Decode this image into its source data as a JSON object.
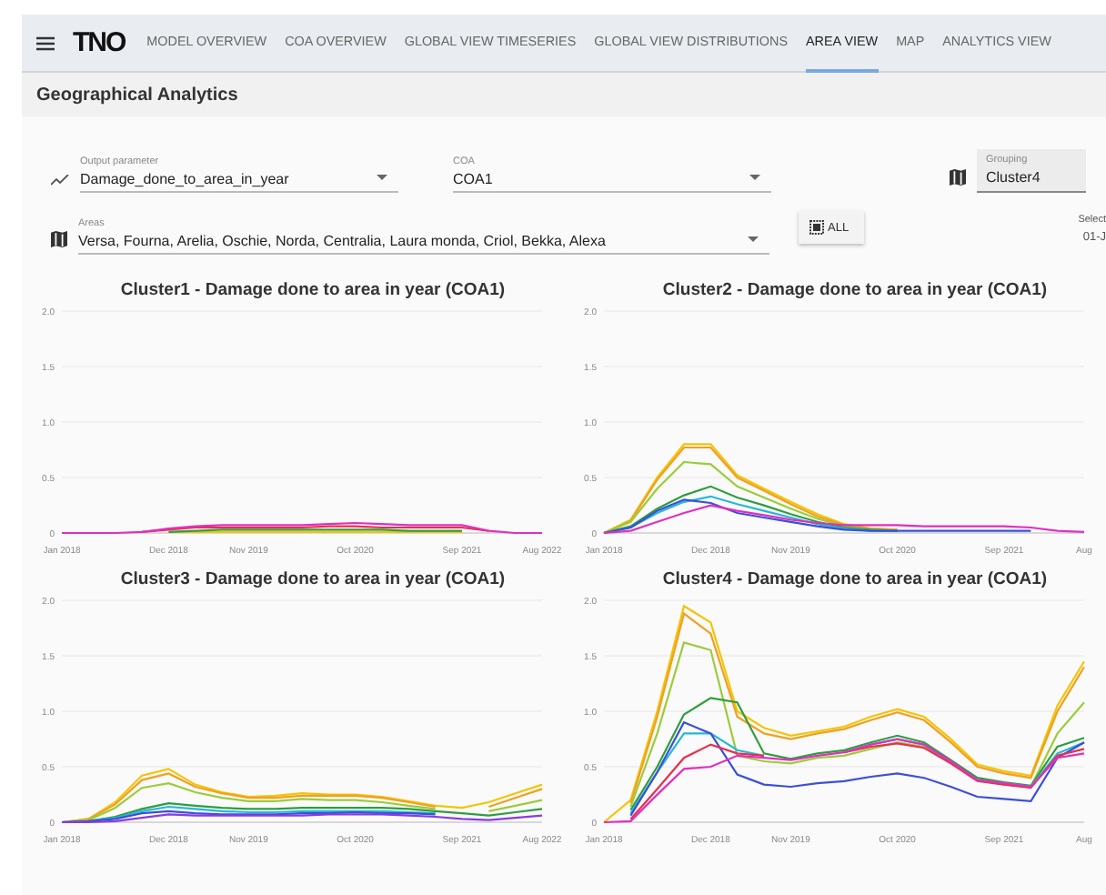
{
  "nav": {
    "logo": "TNO",
    "tabs": [
      {
        "label": "MODEL OVERVIEW",
        "selected": false
      },
      {
        "label": "COA OVERVIEW",
        "selected": false
      },
      {
        "label": "GLOBAL VIEW TIMESERIES",
        "selected": false
      },
      {
        "label": "GLOBAL VIEW DISTRIBUTIONS",
        "selected": false
      },
      {
        "label": "AREA VIEW",
        "selected": true
      },
      {
        "label": "MAP",
        "selected": false
      },
      {
        "label": "ANALYTICS VIEW",
        "selected": false
      }
    ]
  },
  "section_title": "Geographical Analytics",
  "controls": {
    "output_parameter": {
      "label": "Output parameter",
      "value": "Damage_done_to_area_in_year"
    },
    "coa": {
      "label": "COA",
      "value": "COA1"
    },
    "grouping": {
      "label": "Grouping",
      "value": "Cluster4"
    },
    "areas": {
      "label": "Areas",
      "value": "Versa, Fourna, Arelia, Oschie, Norda, Centralia, Laura monda, Criol, Bekka, Alexa"
    },
    "all_button": "ALL",
    "select": {
      "label": "Select",
      "value": "01-J"
    }
  },
  "charts": [
    {
      "chart_data": {
        "type": "line",
        "title": "Cluster1 - Damage done to area in year (COA1)",
        "categories": [
          "Jan 2018",
          null,
          null,
          null,
          "Dec 2018",
          null,
          null,
          "Nov 2019",
          null,
          null,
          null,
          "Oct 2020",
          null,
          null,
          null,
          "Sep 2021",
          null,
          null,
          "Aug 2022"
        ],
        "ylim": [
          0,
          2
        ],
        "grid": true,
        "yticks": [
          {
            "value": 0,
            "label": "0"
          },
          {
            "value": 0.5,
            "label": "0.5"
          },
          {
            "value": 1,
            "label": "1.0"
          },
          {
            "value": 1.5,
            "label": "1.5"
          },
          {
            "value": 2,
            "label": "2.0"
          }
        ],
        "series": [
          {
            "color": "#f5c400",
            "values": [
              null,
              null,
              null,
              null,
              0.01,
              0.01,
              0.01,
              0.01,
              0.01,
              0.01,
              0.01,
              0.01,
              0.01,
              0.01,
              0.01,
              0.01,
              null,
              null,
              null
            ]
          },
          {
            "color": "#2e9e3e",
            "values": [
              null,
              null,
              null,
              null,
              0.01,
              0.02,
              0.03,
              0.03,
              0.03,
              0.03,
              0.03,
              0.03,
              0.03,
              0.02,
              0.02,
              0.02,
              null,
              null,
              null
            ]
          },
          {
            "color": "#e8304a",
            "values": [
              null,
              null,
              null,
              0.01,
              0.03,
              0.05,
              0.05,
              0.05,
              0.05,
              0.05,
              0.06,
              0.06,
              0.05,
              0.05,
              0.05,
              0.05,
              0.02,
              null,
              null
            ]
          },
          {
            "color": "#e030c0",
            "values": [
              0,
              0,
              0,
              0.01,
              0.04,
              0.06,
              0.07,
              0.07,
              0.07,
              0.07,
              0.08,
              0.09,
              0.08,
              0.07,
              0.07,
              0.07,
              0.02,
              0,
              0
            ]
          }
        ]
      }
    },
    {
      "chart_data": {
        "type": "line",
        "title": "Cluster2 - Damage done to area in year (COA1)",
        "categories": [
          "Jan 2018",
          null,
          null,
          null,
          "Dec 2018",
          null,
          null,
          "Nov 2019",
          null,
          null,
          null,
          "Oct 2020",
          null,
          null,
          null,
          "Sep 2021",
          null,
          null,
          "Aug"
        ],
        "ylim": [
          0,
          2
        ],
        "grid": true,
        "yticks": [
          {
            "value": 0,
            "label": "0"
          },
          {
            "value": 0.5,
            "label": "0.5"
          },
          {
            "value": 1,
            "label": "1.0"
          },
          {
            "value": 1.5,
            "label": "1.5"
          },
          {
            "value": 2,
            "label": "2.0"
          }
        ],
        "series": [
          {
            "color": "#f5c400",
            "values": [
              0,
              0.12,
              0.5,
              0.8,
              0.8,
              0.52,
              0.4,
              0.28,
              0.17,
              0.08,
              0.04,
              0.03,
              null,
              null,
              null,
              null,
              null,
              null,
              null
            ]
          },
          {
            "color": "#f0a020",
            "values": [
              0,
              0.11,
              0.48,
              0.77,
              0.77,
              0.5,
              0.38,
              0.26,
              0.15,
              0.07,
              0.04,
              0.03,
              null,
              null,
              null,
              null,
              null,
              null,
              null
            ]
          },
          {
            "color": "#9ccc3c",
            "values": [
              0,
              0.1,
              0.4,
              0.64,
              0.62,
              0.42,
              0.32,
              0.22,
              0.13,
              0.06,
              0.03,
              0.02,
              null,
              null,
              null,
              null,
              null,
              null,
              null
            ]
          },
          {
            "color": "#2e9e3e",
            "values": [
              0,
              0.06,
              0.22,
              0.34,
              0.42,
              0.32,
              0.25,
              0.17,
              0.1,
              0.05,
              0.03,
              0.02,
              null,
              null,
              null,
              null,
              null,
              null,
              null
            ]
          },
          {
            "color": "#25b8d8",
            "values": [
              0,
              0.05,
              0.18,
              0.28,
              0.33,
              0.26,
              0.2,
              0.14,
              0.08,
              0.04,
              0.02,
              0.02,
              null,
              null,
              null,
              null,
              null,
              null,
              null
            ]
          },
          {
            "color": "#3b4fd8",
            "values": [
              0,
              0.05,
              0.2,
              0.3,
              0.27,
              0.18,
              0.14,
              0.1,
              0.06,
              0.03,
              0.02,
              0.02,
              0.02,
              0.02,
              0.02,
              0.02,
              0.02,
              null,
              null
            ]
          },
          {
            "color": "#e030c0",
            "values": [
              0,
              0.02,
              0.1,
              0.18,
              0.25,
              0.2,
              0.16,
              0.12,
              0.09,
              0.07,
              0.07,
              0.07,
              0.06,
              0.06,
              0.06,
              0.06,
              0.05,
              0.02,
              0.01
            ]
          }
        ]
      }
    },
    {
      "chart_data": {
        "type": "line",
        "title": "Cluster3 - Damage done to area in year (COA1)",
        "categories": [
          "Jan 2018",
          null,
          null,
          null,
          "Dec 2018",
          null,
          null,
          "Nov 2019",
          null,
          null,
          null,
          "Oct 2020",
          null,
          null,
          null,
          "Sep 2021",
          null,
          null,
          "Aug 2022"
        ],
        "ylim": [
          0,
          2
        ],
        "grid": true,
        "yticks": [
          {
            "value": 0,
            "label": "0"
          },
          {
            "value": 0.5,
            "label": "0.5"
          },
          {
            "value": 1,
            "label": "1.0"
          },
          {
            "value": 1.5,
            "label": "1.5"
          },
          {
            "value": 2,
            "label": "2.0"
          }
        ],
        "series": [
          {
            "color": "#f5c400",
            "values": [
              0,
              0.03,
              0.18,
              0.42,
              0.48,
              0.34,
              0.27,
              0.23,
              0.24,
              0.26,
              0.25,
              0.25,
              0.23,
              0.19,
              0.15,
              0.13,
              0.18,
              0.26,
              0.34
            ]
          },
          {
            "color": "#f0a020",
            "values": [
              0,
              0.03,
              0.16,
              0.38,
              0.44,
              0.32,
              0.26,
              0.22,
              0.22,
              0.24,
              0.24,
              0.24,
              0.22,
              0.18,
              0.14,
              null,
              0.14,
              0.22,
              0.3
            ]
          },
          {
            "color": "#9ccc3c",
            "values": [
              0,
              0.02,
              0.13,
              0.31,
              0.35,
              0.27,
              0.22,
              0.19,
              0.19,
              0.21,
              0.2,
              0.2,
              0.18,
              0.15,
              0.12,
              null,
              0.1,
              0.15,
              0.2
            ]
          },
          {
            "color": "#2e9e3e",
            "values": [
              0,
              0.01,
              0.05,
              0.12,
              0.17,
              0.15,
              0.13,
              0.12,
              0.12,
              0.13,
              0.13,
              0.13,
              0.13,
              0.12,
              0.1,
              0.08,
              0.06,
              0.09,
              0.12
            ]
          },
          {
            "color": "#25b8d8",
            "values": [
              0,
              0.01,
              0.04,
              0.1,
              0.14,
              0.12,
              0.1,
              0.09,
              0.09,
              0.1,
              0.1,
              0.1,
              0.1,
              0.09,
              0.08,
              null,
              null,
              null,
              null
            ]
          },
          {
            "color": "#3b4fd8",
            "values": [
              0,
              0.01,
              0.03,
              0.08,
              0.1,
              0.08,
              0.07,
              0.07,
              0.07,
              0.08,
              0.08,
              0.09,
              0.08,
              0.08,
              0.07,
              null,
              null,
              null,
              null
            ]
          },
          {
            "color": "#8a3be0",
            "values": [
              0,
              0,
              0.01,
              0.04,
              0.07,
              0.06,
              0.06,
              0.06,
              0.06,
              0.06,
              0.07,
              0.07,
              0.07,
              0.06,
              0.05,
              0.03,
              0.02,
              0.04,
              0.06
            ]
          }
        ]
      }
    },
    {
      "chart_data": {
        "type": "line",
        "title": "Cluster4 - Damage done to area in year (COA1)",
        "categories": [
          "Jan 2018",
          null,
          null,
          null,
          "Dec 2018",
          null,
          null,
          "Nov 2019",
          null,
          null,
          null,
          "Oct 2020",
          null,
          null,
          null,
          "Sep 2021",
          null,
          null,
          "Aug"
        ],
        "ylim": [
          0,
          2
        ],
        "grid": true,
        "yticks": [
          {
            "value": 0,
            "label": "0"
          },
          {
            "value": 0.5,
            "label": "0.5"
          },
          {
            "value": 1,
            "label": "1.0"
          },
          {
            "value": 1.5,
            "label": "1.5"
          },
          {
            "value": 2,
            "label": "2.0"
          }
        ],
        "series": [
          {
            "color": "#f5c400",
            "values": [
              0,
              0.2,
              1.0,
              1.95,
              1.8,
              1.0,
              0.85,
              0.78,
              0.82,
              0.86,
              0.95,
              1.02,
              0.95,
              0.75,
              0.52,
              0.46,
              0.42,
              1.05,
              1.45
            ]
          },
          {
            "color": "#f0a020",
            "values": [
              null,
              0.17,
              0.95,
              1.88,
              1.7,
              0.95,
              0.8,
              0.75,
              0.8,
              0.84,
              0.92,
              0.99,
              0.92,
              0.72,
              0.5,
              0.44,
              0.4,
              1.0,
              1.4
            ]
          },
          {
            "color": "#9ccc3c",
            "values": [
              null,
              0.14,
              0.8,
              1.62,
              1.55,
              0.6,
              0.55,
              0.53,
              0.58,
              0.6,
              0.66,
              0.72,
              0.68,
              0.55,
              0.38,
              0.34,
              0.32,
              0.8,
              1.08
            ]
          },
          {
            "color": "#2e9e3e",
            "values": [
              null,
              0.11,
              0.5,
              0.97,
              1.12,
              1.08,
              0.62,
              0.57,
              0.62,
              0.65,
              0.72,
              0.78,
              0.72,
              0.56,
              0.4,
              0.36,
              0.33,
              0.68,
              0.76
            ]
          },
          {
            "color": "#25b8d8",
            "values": [
              null,
              0.08,
              0.45,
              0.8,
              0.8,
              0.65,
              0.6,
              null,
              null,
              0.63,
              0.7,
              0.75,
              0.7,
              0.54,
              0.38,
              0.35,
              0.32,
              0.62,
              0.72
            ]
          },
          {
            "color": "#3b4fd8",
            "values": [
              null,
              0.06,
              0.45,
              0.9,
              0.8,
              0.43,
              0.34,
              0.32,
              0.35,
              0.37,
              0.41,
              0.44,
              0.4,
              0.32,
              0.23,
              0.21,
              0.19,
              0.58,
              0.72
            ]
          },
          {
            "color": "#e8304a",
            "values": [
              null,
              0.03,
              0.3,
              0.58,
              0.7,
              0.62,
              0.6,
              null,
              null,
              0.63,
              0.68,
              0.71,
              0.67,
              0.53,
              0.37,
              0.34,
              0.31,
              0.6,
              0.66
            ]
          },
          {
            "color": "#e030c0",
            "values": [
              0,
              0.01,
              0.25,
              0.48,
              0.5,
              0.6,
              0.58,
              0.56,
              0.6,
              0.63,
              0.7,
              0.75,
              0.7,
              0.55,
              0.38,
              0.35,
              0.32,
              0.58,
              0.62
            ]
          }
        ]
      }
    }
  ]
}
